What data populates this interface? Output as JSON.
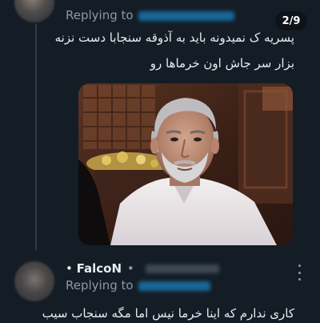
{
  "first_reply": {
    "replying_label": "Replying to",
    "media_counter": "2/9",
    "text_line1": "پسریه ک نمیدونه باید به آذوقه سنجابا دست نزنه",
    "text_line2": "بزار سر جاش اون خرماها رو"
  },
  "second_reply": {
    "bullet": "•",
    "author_name": "FalcoN",
    "separator": "•",
    "replying_label": "Replying to",
    "text_line1": "کاری ندارم که اینا خرما نیس اما مگه سنجاب سیب"
  },
  "colors": {
    "background": "#141d26",
    "text": "#e6ecf0",
    "secondary": "#8899a6",
    "thread_line": "#2c3a47",
    "mention": "#1da1f2"
  },
  "icons": [
    "more-vertical-icon"
  ]
}
